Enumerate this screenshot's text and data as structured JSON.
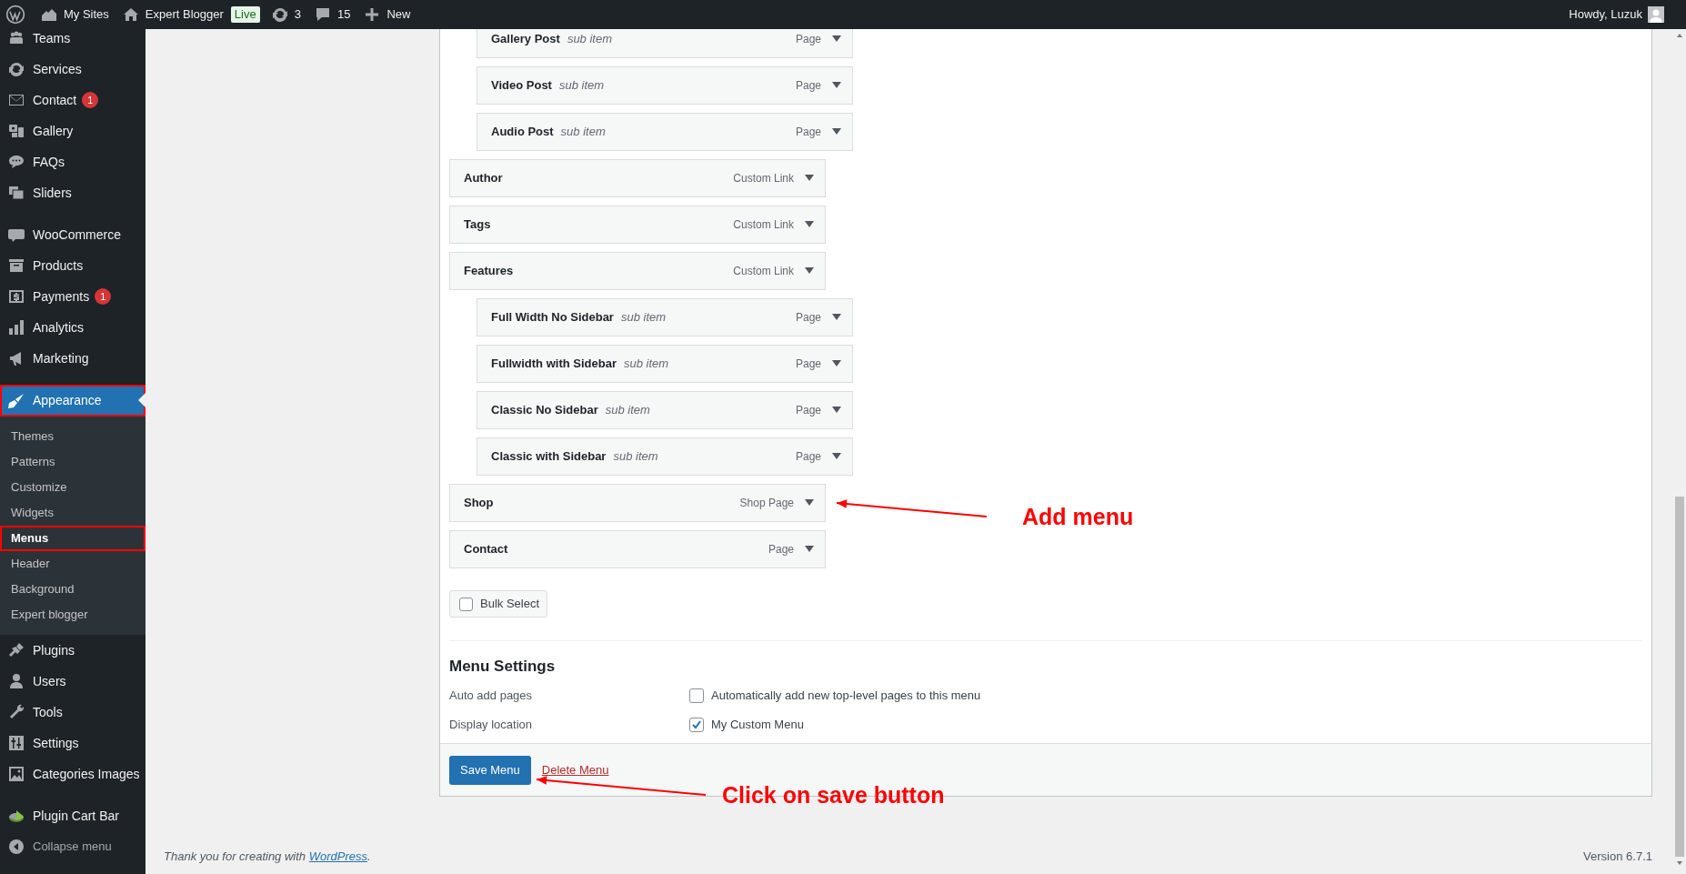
{
  "admin_bar": {
    "items": [
      {
        "kind": "logo"
      },
      {
        "kind": "sites",
        "label": "My Sites"
      },
      {
        "kind": "home",
        "label": "Expert Blogger",
        "badge": "Live"
      },
      {
        "kind": "updates",
        "label": "3"
      },
      {
        "kind": "comments",
        "label": "15"
      },
      {
        "kind": "new",
        "label": "New"
      }
    ],
    "greeting": "Howdy, Luzuk"
  },
  "sidebar": {
    "groups": [
      {
        "items": [
          {
            "label": "Teams",
            "selected": false,
            "outlined": false
          },
          {
            "label": "Services",
            "selected": false,
            "outlined": false
          },
          {
            "label": "Contact",
            "badge": "1",
            "selected": false,
            "outlined": false
          },
          {
            "label": "Gallery",
            "selected": false,
            "outlined": false
          },
          {
            "label": "FAQs",
            "selected": false,
            "outlined": false
          },
          {
            "label": "Sliders",
            "selected": false,
            "outlined": false
          }
        ]
      },
      {
        "items": [
          {
            "label": "WooCommerce",
            "selected": false,
            "outlined": false
          },
          {
            "label": "Products",
            "selected": false,
            "outlined": false
          },
          {
            "label": "Payments",
            "badge": "1",
            "selected": false,
            "outlined": false
          },
          {
            "label": "Analytics",
            "selected": false,
            "outlined": false
          },
          {
            "label": "Marketing",
            "selected": false,
            "outlined": false
          }
        ]
      },
      {
        "items": [
          {
            "label": "Appearance",
            "selected": true,
            "outlined": true,
            "children": [
              {
                "label": "Themes",
                "selected": false,
                "outlined": false
              },
              {
                "label": "Patterns",
                "selected": false,
                "outlined": false
              },
              {
                "label": "Customize",
                "selected": false,
                "outlined": false
              },
              {
                "label": "Widgets",
                "selected": false,
                "outlined": false
              },
              {
                "label": "Menus",
                "selected": true,
                "outlined": true
              },
              {
                "label": "Header",
                "selected": false,
                "outlined": false
              },
              {
                "label": "Background",
                "selected": false,
                "outlined": false
              },
              {
                "label": "Expert blogger",
                "selected": false,
                "outlined": false
              }
            ]
          },
          {
            "label": "Plugins",
            "selected": false,
            "outlined": false
          },
          {
            "label": "Users",
            "selected": false,
            "outlined": false
          },
          {
            "label": "Tools",
            "selected": false,
            "outlined": false
          },
          {
            "label": "Settings",
            "selected": false,
            "outlined": false
          },
          {
            "label": "Categories Images",
            "selected": false,
            "outlined": false
          }
        ]
      },
      {
        "items": [
          {
            "label": "Plugin Cart Bar",
            "selected": false,
            "outlined": false
          }
        ]
      }
    ],
    "collapse": "Collapse menu"
  },
  "menu_items": [
    {
      "children": [
        {
          "title": "Gallery Post",
          "note": "sub item",
          "type": "Page"
        },
        {
          "title": "Video Post",
          "note": "sub item",
          "type": "Page"
        },
        {
          "title": "Audio Post",
          "note": "sub item",
          "type": "Page"
        }
      ]
    },
    {
      "title": "Author",
      "type": "Custom Link"
    },
    {
      "title": "Tags",
      "type": "Custom Link"
    },
    {
      "title": "Features",
      "type": "Custom Link",
      "children": [
        {
          "title": "Full Width No Sidebar",
          "note": "sub item",
          "type": "Page"
        },
        {
          "title": "Fullwidth with Sidebar",
          "note": "sub item",
          "type": "Page"
        },
        {
          "title": "Classic No Sidebar",
          "note": "sub item",
          "type": "Page"
        },
        {
          "title": "Classic with Sidebar",
          "note": "sub item",
          "type": "Page"
        }
      ]
    },
    {
      "title": "Shop",
      "type": "Shop Page"
    },
    {
      "title": "Contact",
      "type": "Page"
    }
  ],
  "bulk_select": {
    "label": "Bulk Select",
    "checked": false
  },
  "menu_settings": {
    "heading": "Menu Settings",
    "rows": [
      {
        "label": "Auto add pages",
        "option": "Automatically add new top-level pages to this menu",
        "checked": false
      },
      {
        "label": "Display location",
        "option": "My Custom Menu",
        "checked": true
      }
    ]
  },
  "actions": {
    "save": "Save Menu",
    "delete": "Delete Menu"
  },
  "annotations": [
    {
      "kind": "add",
      "text": "Add menu"
    },
    {
      "kind": "save",
      "text": "Click on save button"
    }
  ],
  "footer": {
    "credit": "Thank you for creating with",
    "credit_link": "WordPress",
    "credit_end": ".",
    "version": "Version 6.7.1"
  }
}
